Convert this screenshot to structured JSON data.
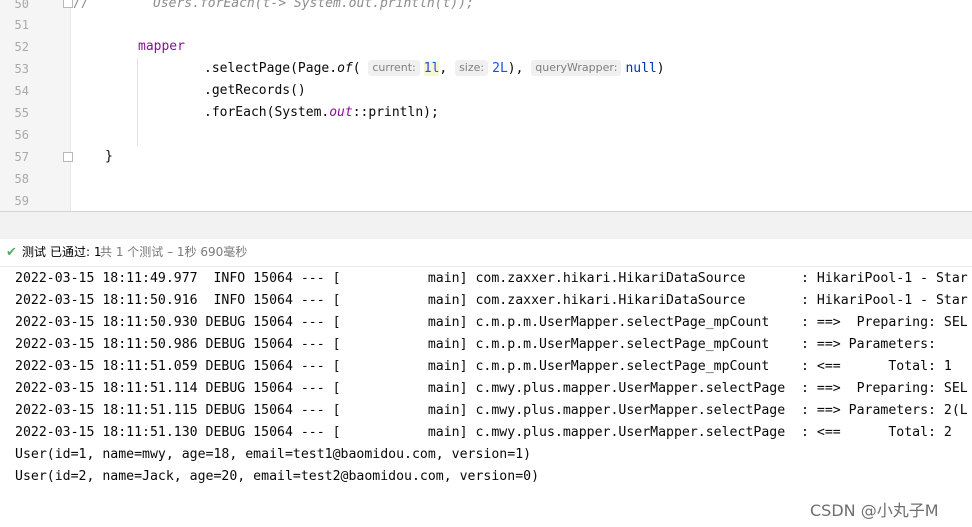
{
  "editor": {
    "lines": [
      {
        "num": "50",
        "prefix": "//",
        "code": "Users.forEach(t-> System.out.println(t));"
      },
      {
        "num": "51"
      },
      {
        "num": "52",
        "code": "mapper"
      },
      {
        "num": "53",
        "code_a": ".selectPage(Page.",
        "code_of": "of",
        "code_b": "(",
        "hint_current": "current:",
        "val_current": "1l",
        "sep1": ",",
        "hint_size": "size:",
        "val_size": "2L",
        "code_c": "),",
        "hint_query": "queryWrapper:",
        "val_null": "null",
        "code_d": ")"
      },
      {
        "num": "54",
        "code": ".getRecords()"
      },
      {
        "num": "55",
        "code_a": ".forEach(System.",
        "code_out": "out",
        "code_b": "::println);"
      },
      {
        "num": "56"
      },
      {
        "num": "57",
        "code": "}"
      },
      {
        "num": "58"
      },
      {
        "num": "59"
      }
    ]
  },
  "testbar": {
    "title": "测试",
    "passed": "已通过: 1",
    "count_prefix": "共",
    "summary": "共 1 个测试 – 1秒 690毫秒"
  },
  "console": {
    "lines": [
      "2022-03-15 18:11:49.977  INFO 15064 --- [           main] com.zaxxer.hikari.HikariDataSource       : HikariPool-1 - Star",
      "2022-03-15 18:11:50.916  INFO 15064 --- [           main] com.zaxxer.hikari.HikariDataSource       : HikariPool-1 - Star",
      "2022-03-15 18:11:50.930 DEBUG 15064 --- [           main] c.m.p.m.UserMapper.selectPage_mpCount    : ==>  Preparing: SEL",
      "2022-03-15 18:11:50.986 DEBUG 15064 --- [           main] c.m.p.m.UserMapper.selectPage_mpCount    : ==> Parameters: ",
      "2022-03-15 18:11:51.059 DEBUG 15064 --- [           main] c.m.p.m.UserMapper.selectPage_mpCount    : <==      Total: 1",
      "2022-03-15 18:11:51.114 DEBUG 15064 --- [           main] c.mwy.plus.mapper.UserMapper.selectPage  : ==>  Preparing: SEL",
      "2022-03-15 18:11:51.115 DEBUG 15064 --- [           main] c.mwy.plus.mapper.UserMapper.selectPage  : ==> Parameters: 2(L",
      "2022-03-15 18:11:51.130 DEBUG 15064 --- [           main] c.mwy.plus.mapper.UserMapper.selectPage  : <==      Total: 2",
      "User(id=1, name=mwy, age=18, email=test1@baomidou.com, version=1)",
      "User(id=2, name=Jack, age=20, email=test2@baomidou.com, version=0)"
    ]
  },
  "watermark": "CSDN @小丸子M",
  "colors": {
    "keyword": "#0033b3",
    "field": "#871094",
    "number": "#1750eb",
    "comment": "#8c8c8c",
    "pass": "#59a869"
  },
  "icons": {
    "pass": "check-icon"
  }
}
